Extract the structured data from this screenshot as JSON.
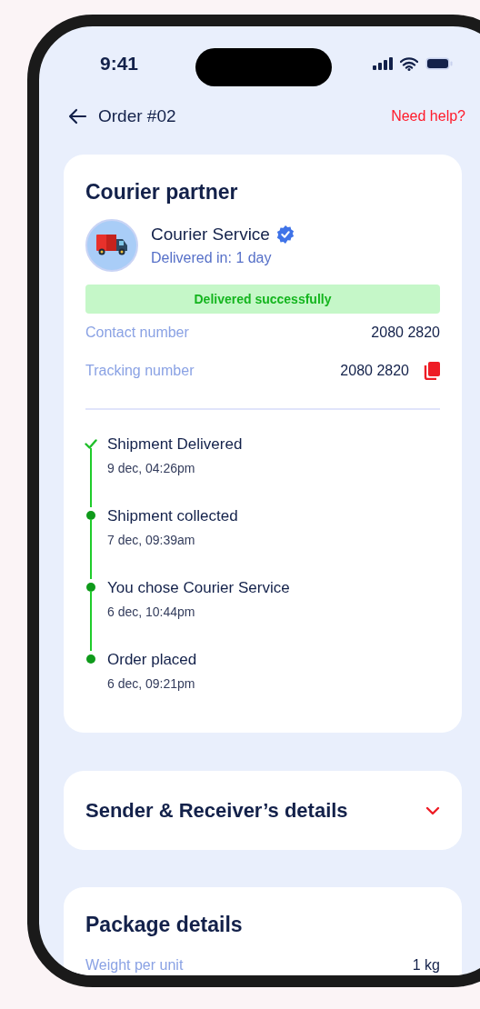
{
  "status_bar": {
    "time": "9:41"
  },
  "header": {
    "title": "Order #02",
    "help_link": "Need help?"
  },
  "courier_card": {
    "title": "Courier partner",
    "name": "Courier Service",
    "verified": true,
    "delivery_time": "Delivered in: 1 day",
    "status": "Delivered successfully",
    "details": [
      {
        "label": "Contact number",
        "value": "2080 2820",
        "copyable": false
      },
      {
        "label": "Tracking number",
        "value": "2080 2820",
        "copyable": true
      }
    ],
    "timeline": [
      {
        "kind": "check",
        "title": "Shipment Delivered",
        "time": "9 dec, 04:26pm"
      },
      {
        "kind": "dot",
        "title": "Shipment collected",
        "time": "7 dec, 09:39am"
      },
      {
        "kind": "dot",
        "title": "You chose Courier Service",
        "time": "6 dec, 10:44pm"
      },
      {
        "kind": "dot",
        "title": "Order placed",
        "time": "6 dec, 09:21pm"
      }
    ]
  },
  "sender_section": {
    "title": "Sender & Receiver’s details",
    "expanded": false
  },
  "package_card": {
    "title": "Package details",
    "details": [
      {
        "label": "Weight per unit",
        "value": "1 kg"
      }
    ]
  }
}
